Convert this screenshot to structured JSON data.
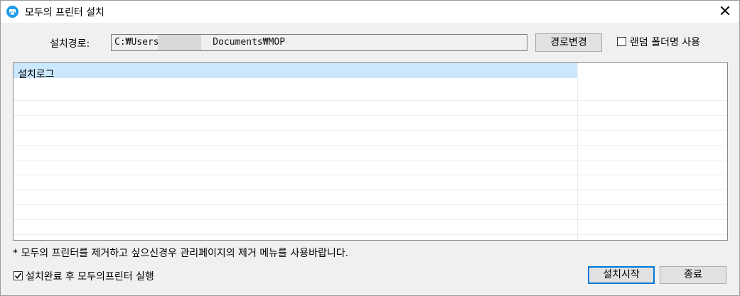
{
  "window": {
    "title": "모두의 프린터 설치",
    "icon": "printer-app-icon",
    "close_icon": "close-icon"
  },
  "install_path": {
    "label": "설치경로:",
    "value_prefix": "C:₩Users",
    "value_suffix": "Documents₩MOP",
    "change_button": "경로변경"
  },
  "random_folder": {
    "label": "랜덤 폴더명 사용",
    "checked": false
  },
  "log": {
    "column_header": "설치로그",
    "rows": [
      "",
      "",
      "",
      "",
      "",
      "",
      "",
      "",
      "",
      "",
      ""
    ]
  },
  "notice": "* 모두의 프린터를 제거하고 싶으신경우 관리페이지의  제거 메뉴를 사용바랍니다.",
  "run_after": {
    "label": "설치완료 후 모두의프린터 실행",
    "checked": true
  },
  "buttons": {
    "start": "설치시작",
    "exit": "종료"
  },
  "colors": {
    "accent": "#0078d7",
    "selection": "#cce8ff",
    "window_bg": "#f0f0f0"
  }
}
